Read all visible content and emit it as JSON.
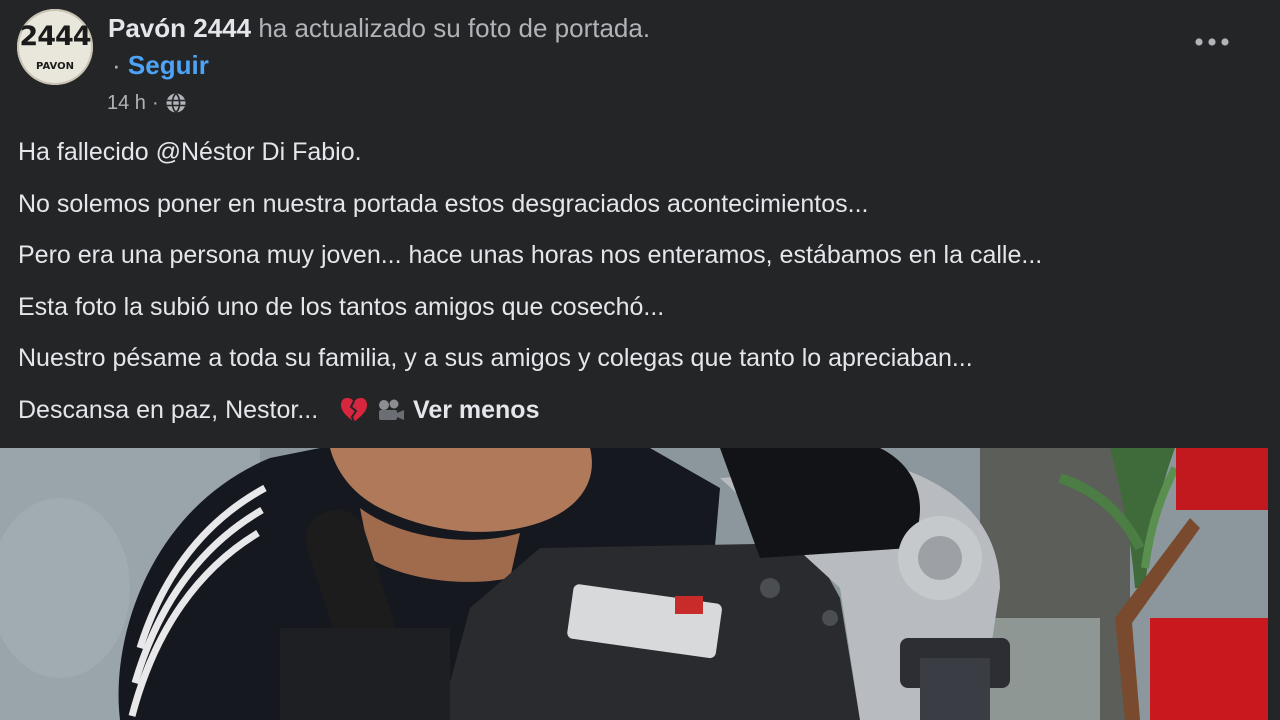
{
  "post": {
    "avatar": {
      "number": "2444",
      "brand": "PAVON"
    },
    "author": "Pavón 2444",
    "action": "ha actualizado su foto de portada.",
    "separator": "·",
    "follow_label": "Seguir",
    "timestamp": "14 h",
    "time_separator": "·",
    "audience_icon": "globe-icon",
    "menu_icon": "more-options-icon",
    "paragraphs": [
      "Ha fallecido @Néstor Di Fabio.",
      "No solemos poner en nuestra portada estos desgraciados  acontecimientos...",
      "Pero era una persona muy joven... hace unas horas nos enteramos, estábamos en la calle...",
      "Esta foto la subió uno de los tantos amigos que cosechó...",
      "Nuestro pésame a toda su familia, y a sus amigos y colegas que tanto lo apreciaban..."
    ],
    "last_paragraph": "Descansa en paz, Nestor...",
    "emojis": [
      "broken-heart-emoji",
      "movie-camera-emoji"
    ],
    "see_less_label": "Ver menos",
    "photo_icon": "cover-photo"
  },
  "colors": {
    "background": "#242526",
    "primary_text": "#e4e6eb",
    "secondary_text": "#b0b3b8",
    "link_blue": "#4da3f5"
  }
}
